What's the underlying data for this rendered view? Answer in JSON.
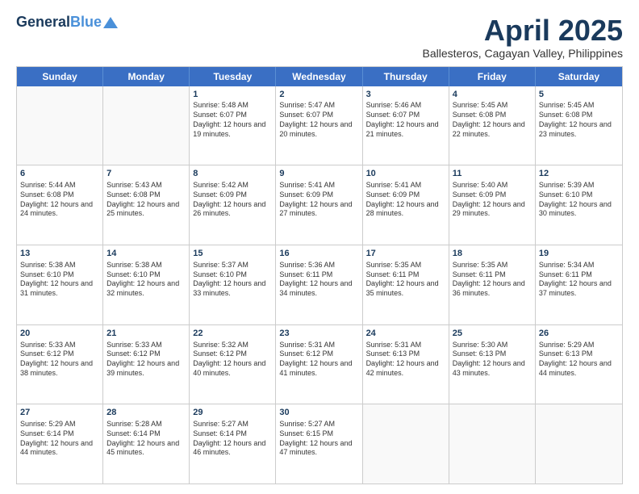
{
  "logo": {
    "line1": "General",
    "line2": "Blue"
  },
  "title": "April 2025",
  "location": "Ballesteros, Cagayan Valley, Philippines",
  "header_days": [
    "Sunday",
    "Monday",
    "Tuesday",
    "Wednesday",
    "Thursday",
    "Friday",
    "Saturday"
  ],
  "weeks": [
    [
      {
        "day": "",
        "info": ""
      },
      {
        "day": "",
        "info": ""
      },
      {
        "day": "1",
        "info": "Sunrise: 5:48 AM\nSunset: 6:07 PM\nDaylight: 12 hours and 19 minutes."
      },
      {
        "day": "2",
        "info": "Sunrise: 5:47 AM\nSunset: 6:07 PM\nDaylight: 12 hours and 20 minutes."
      },
      {
        "day": "3",
        "info": "Sunrise: 5:46 AM\nSunset: 6:07 PM\nDaylight: 12 hours and 21 minutes."
      },
      {
        "day": "4",
        "info": "Sunrise: 5:45 AM\nSunset: 6:08 PM\nDaylight: 12 hours and 22 minutes."
      },
      {
        "day": "5",
        "info": "Sunrise: 5:45 AM\nSunset: 6:08 PM\nDaylight: 12 hours and 23 minutes."
      }
    ],
    [
      {
        "day": "6",
        "info": "Sunrise: 5:44 AM\nSunset: 6:08 PM\nDaylight: 12 hours and 24 minutes."
      },
      {
        "day": "7",
        "info": "Sunrise: 5:43 AM\nSunset: 6:08 PM\nDaylight: 12 hours and 25 minutes."
      },
      {
        "day": "8",
        "info": "Sunrise: 5:42 AM\nSunset: 6:09 PM\nDaylight: 12 hours and 26 minutes."
      },
      {
        "day": "9",
        "info": "Sunrise: 5:41 AM\nSunset: 6:09 PM\nDaylight: 12 hours and 27 minutes."
      },
      {
        "day": "10",
        "info": "Sunrise: 5:41 AM\nSunset: 6:09 PM\nDaylight: 12 hours and 28 minutes."
      },
      {
        "day": "11",
        "info": "Sunrise: 5:40 AM\nSunset: 6:09 PM\nDaylight: 12 hours and 29 minutes."
      },
      {
        "day": "12",
        "info": "Sunrise: 5:39 AM\nSunset: 6:10 PM\nDaylight: 12 hours and 30 minutes."
      }
    ],
    [
      {
        "day": "13",
        "info": "Sunrise: 5:38 AM\nSunset: 6:10 PM\nDaylight: 12 hours and 31 minutes."
      },
      {
        "day": "14",
        "info": "Sunrise: 5:38 AM\nSunset: 6:10 PM\nDaylight: 12 hours and 32 minutes."
      },
      {
        "day": "15",
        "info": "Sunrise: 5:37 AM\nSunset: 6:10 PM\nDaylight: 12 hours and 33 minutes."
      },
      {
        "day": "16",
        "info": "Sunrise: 5:36 AM\nSunset: 6:11 PM\nDaylight: 12 hours and 34 minutes."
      },
      {
        "day": "17",
        "info": "Sunrise: 5:35 AM\nSunset: 6:11 PM\nDaylight: 12 hours and 35 minutes."
      },
      {
        "day": "18",
        "info": "Sunrise: 5:35 AM\nSunset: 6:11 PM\nDaylight: 12 hours and 36 minutes."
      },
      {
        "day": "19",
        "info": "Sunrise: 5:34 AM\nSunset: 6:11 PM\nDaylight: 12 hours and 37 minutes."
      }
    ],
    [
      {
        "day": "20",
        "info": "Sunrise: 5:33 AM\nSunset: 6:12 PM\nDaylight: 12 hours and 38 minutes."
      },
      {
        "day": "21",
        "info": "Sunrise: 5:33 AM\nSunset: 6:12 PM\nDaylight: 12 hours and 39 minutes."
      },
      {
        "day": "22",
        "info": "Sunrise: 5:32 AM\nSunset: 6:12 PM\nDaylight: 12 hours and 40 minutes."
      },
      {
        "day": "23",
        "info": "Sunrise: 5:31 AM\nSunset: 6:12 PM\nDaylight: 12 hours and 41 minutes."
      },
      {
        "day": "24",
        "info": "Sunrise: 5:31 AM\nSunset: 6:13 PM\nDaylight: 12 hours and 42 minutes."
      },
      {
        "day": "25",
        "info": "Sunrise: 5:30 AM\nSunset: 6:13 PM\nDaylight: 12 hours and 43 minutes."
      },
      {
        "day": "26",
        "info": "Sunrise: 5:29 AM\nSunset: 6:13 PM\nDaylight: 12 hours and 44 minutes."
      }
    ],
    [
      {
        "day": "27",
        "info": "Sunrise: 5:29 AM\nSunset: 6:14 PM\nDaylight: 12 hours and 44 minutes."
      },
      {
        "day": "28",
        "info": "Sunrise: 5:28 AM\nSunset: 6:14 PM\nDaylight: 12 hours and 45 minutes."
      },
      {
        "day": "29",
        "info": "Sunrise: 5:27 AM\nSunset: 6:14 PM\nDaylight: 12 hours and 46 minutes."
      },
      {
        "day": "30",
        "info": "Sunrise: 5:27 AM\nSunset: 6:15 PM\nDaylight: 12 hours and 47 minutes."
      },
      {
        "day": "",
        "info": ""
      },
      {
        "day": "",
        "info": ""
      },
      {
        "day": "",
        "info": ""
      }
    ]
  ]
}
